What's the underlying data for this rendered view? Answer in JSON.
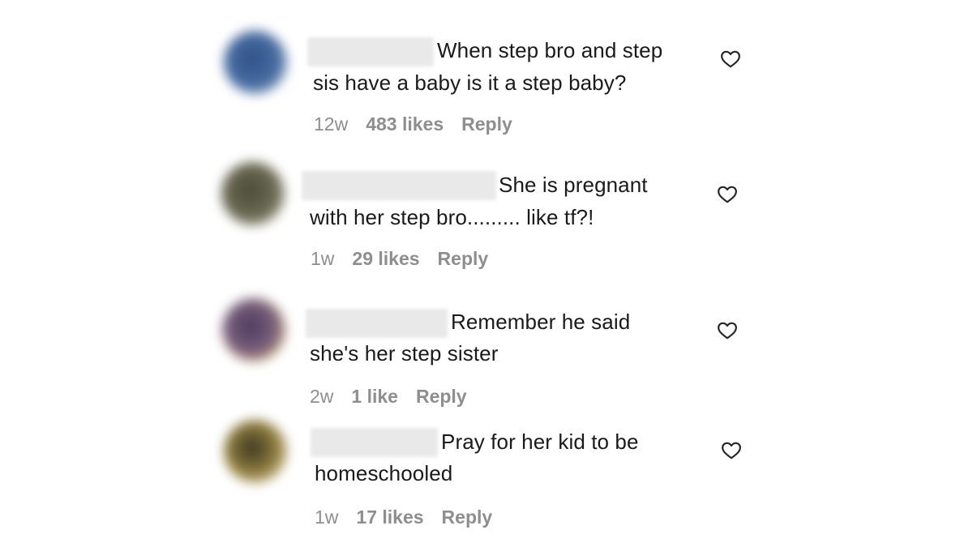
{
  "comments": [
    {
      "text_first": "When step bro and step",
      "text_second": "sis have a baby is it a step baby?",
      "age": "12w",
      "likes": "483 likes",
      "reply": "Reply",
      "avatar_color": "#3b5f8f"
    },
    {
      "text_first": "She is pregnant",
      "text_second": "with her step bro......... like tf?!",
      "age": "1w",
      "likes": "29 likes",
      "reply": "Reply",
      "avatar_color": "#5b5a48"
    },
    {
      "text_first": "Remember he said",
      "text_second": "she's her step sister",
      "age": "2w",
      "likes": "1 like",
      "reply": "Reply",
      "avatar_color": "#6b5570"
    },
    {
      "text_first": "Pray for her kid to be",
      "text_second": "homeschooled",
      "age": "1w",
      "likes": "17 likes",
      "reply": "Reply",
      "avatar_color": "#8a7a45"
    }
  ],
  "icons": {
    "like": "heart-outline-icon"
  },
  "colors": {
    "meta": "#8e8e8e",
    "text": "#1a1a1a",
    "background": "#ffffff"
  }
}
